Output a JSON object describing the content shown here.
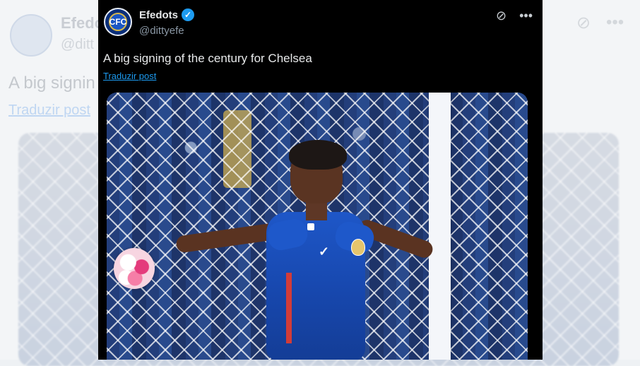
{
  "post": {
    "display_name": "Efedots",
    "handle": "@dittyefe",
    "text": "A big signing of the century for Chelsea",
    "translate_label": "Traduzir post",
    "avatar_label": "CFC"
  },
  "background_post": {
    "display_name_fragment": "Efedo",
    "handle_fragment": "@ditt",
    "text_fragment": "A big signin",
    "translate_label": "Traduzir post"
  },
  "icons": {
    "verified": "verified-badge-icon",
    "grok": "grok-icon",
    "more": "more-icon",
    "nike": "nike-swoosh-icon"
  },
  "colors": {
    "card_background": "#000000",
    "link": "#1d9bf0",
    "verified": "#1d9bf0",
    "text_primary": "#e7e9ea",
    "text_secondary": "#8b98a5"
  }
}
